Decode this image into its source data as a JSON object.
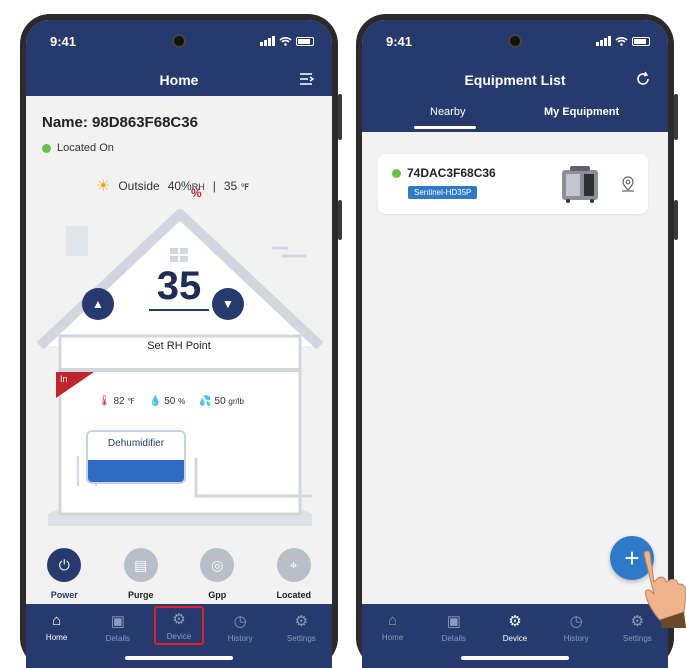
{
  "home_phone": {
    "status_time": "9:41",
    "title": "Home",
    "device_name": "Name: 98D863F68C36",
    "located_status": "Located On",
    "outside": {
      "label": "Outside",
      "rh": "40%",
      "rh_unit": "RH",
      "separator": "|",
      "temp": "35",
      "temp_unit": "℉"
    },
    "setpoint": {
      "value": "35",
      "unit": "%",
      "label": "Set RH Point"
    },
    "inside": {
      "badge": "In",
      "temp": "82",
      "temp_unit": "℉",
      "rh": "50",
      "rh_unit": "%",
      "gpp": "50",
      "gpp_unit": "gr/lb"
    },
    "dehumidifier_label": "Dehumidifier",
    "controls": [
      {
        "label": "Power",
        "icon": "power-icon"
      },
      {
        "label": "Purge",
        "icon": "purge-icon"
      },
      {
        "label": "Gpp",
        "icon": "gpp-icon"
      },
      {
        "label": "Located",
        "icon": "locate-icon"
      }
    ],
    "tabs": [
      {
        "label": "Home",
        "icon": "home-icon"
      },
      {
        "label": "Details",
        "icon": "details-icon"
      },
      {
        "label": "Device",
        "icon": "gear-icon"
      },
      {
        "label": "History",
        "icon": "history-icon"
      },
      {
        "label": "Settings",
        "icon": "settings-icon"
      }
    ]
  },
  "equipment_phone": {
    "status_time": "9:41",
    "title": "Equipment List",
    "segments": [
      "Nearby",
      "My Equipment"
    ],
    "device": {
      "serial": "74DAC3F68C36",
      "model": "Sentinel-HD35P"
    },
    "fab_label": "+",
    "tabs": [
      {
        "label": "Home",
        "icon": "home-icon"
      },
      {
        "label": "Details",
        "icon": "details-icon"
      },
      {
        "label": "Device",
        "icon": "gear-icon"
      },
      {
        "label": "History",
        "icon": "history-icon"
      },
      {
        "label": "Settings",
        "icon": "settings-icon"
      }
    ]
  },
  "colors": {
    "navy": "#263a6e",
    "accent_blue": "#2f79c7",
    "status_green": "#6cc04a",
    "highlight_red": "#e0202c"
  }
}
